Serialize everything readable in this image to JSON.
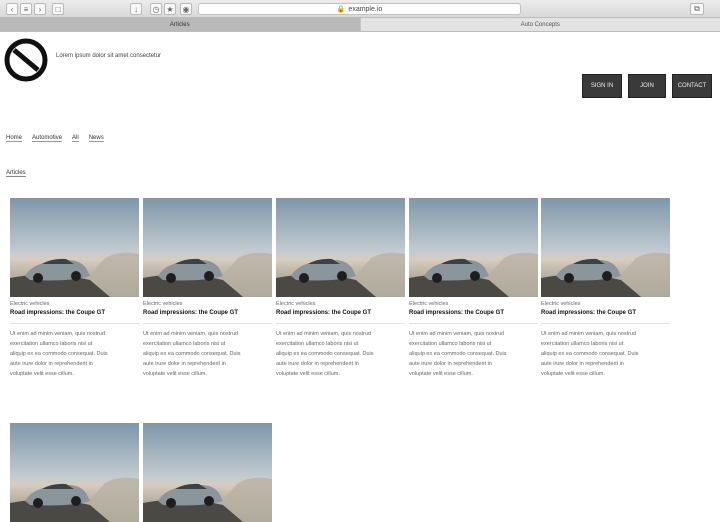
{
  "browser": {
    "url": "example.io",
    "tabs": [
      {
        "label": "Articles",
        "active": true
      },
      {
        "label": "Auto Concepts",
        "active": false
      }
    ]
  },
  "header": {
    "tagline": "Lorem ipsum dolor sit amet consectetur"
  },
  "actions": [
    {
      "label": "SIGN IN"
    },
    {
      "label": "JOIN"
    },
    {
      "label": "CONTACT"
    }
  ],
  "breadcrumb": [
    "Home",
    "Automotive",
    "All",
    "News"
  ],
  "section": {
    "title": "Articles"
  },
  "cards": [
    {
      "category": "Electric vehicles",
      "title": "Road impressions: the Coupe GT",
      "desc": [
        "Ut enim ad minim veniam, quis nostrud",
        "exercitation ullamco laboris nisi ut",
        "aliquip ex ea commodo consequat. Duis",
        "aute irure dolor in reprehenderit in",
        "voluptate velit esse cillum."
      ]
    },
    {
      "category": "Electric vehicles",
      "title": "Road impressions: the Coupe GT",
      "desc": [
        "Ut enim ad minim veniam, quis nostrud",
        "exercitation ullamco laboris nisi ut",
        "aliquip ex ea commodo consequat. Duis",
        "aute irure dolor in reprehenderit in",
        "voluptate velit esse cillum."
      ]
    },
    {
      "category": "Electric vehicles",
      "title": "Road impressions: the Coupe GT",
      "desc": [
        "Ut enim ad minim veniam, quis nostrud",
        "exercitation ullamco laboris nisi ut",
        "aliquip ex ea commodo consequat. Duis",
        "aute irure dolor in reprehenderit in",
        "voluptate velit esse cillum."
      ]
    },
    {
      "category": "Electric vehicles",
      "title": "Road impressions: the Coupe GT",
      "desc": [
        "Ut enim ad minim veniam, quis nostrud",
        "exercitation ullamco laboris nisi ut",
        "aliquip ex ea commodo consequat. Duis",
        "aute irure dolor in reprehenderit in",
        "voluptate velit esse cillum."
      ]
    },
    {
      "category": "Electric vehicles",
      "title": "Road impressions: the Coupe GT",
      "desc": [
        "Ut enim ad minim veniam, quis nostrud",
        "exercitation ullamco laboris nisi ut",
        "aliquip ex ea commodo consequat. Duis",
        "aute irure dolor in reprehenderit in",
        "voluptate velit esse cillum."
      ]
    },
    {
      "category": "",
      "title": "",
      "desc": []
    },
    {
      "category": "",
      "title": "",
      "desc": []
    }
  ]
}
